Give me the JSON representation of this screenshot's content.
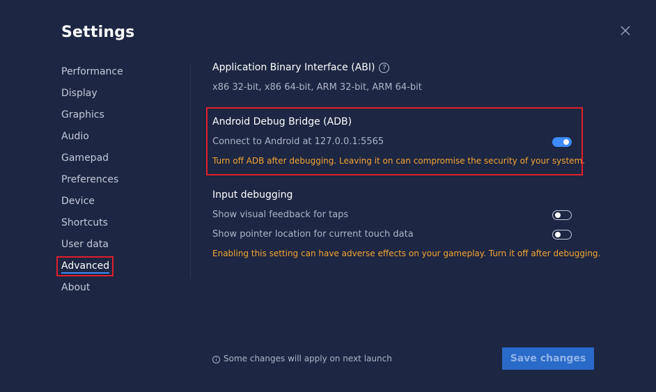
{
  "title": "Settings",
  "sidebar": {
    "items": [
      {
        "label": "Performance"
      },
      {
        "label": "Display"
      },
      {
        "label": "Graphics"
      },
      {
        "label": "Audio"
      },
      {
        "label": "Gamepad"
      },
      {
        "label": "Preferences"
      },
      {
        "label": "Device"
      },
      {
        "label": "Shortcuts"
      },
      {
        "label": "User data"
      },
      {
        "label": "Advanced"
      },
      {
        "label": "About"
      }
    ],
    "active": "Advanced"
  },
  "abi": {
    "title": "Application Binary Interface (ABI)",
    "help_icon": "?",
    "value": "x86 32-bit, x86 64-bit, ARM 32-bit, ARM 64-bit"
  },
  "adb": {
    "title": "Android Debug Bridge (ADB)",
    "connect_label": "Connect to Android at 127.0.0.1:5565",
    "enabled": true,
    "warning": "Turn off ADB after debugging. Leaving it on can compromise the security of your system."
  },
  "input_debugging": {
    "title": "Input debugging",
    "taps_label": "Show visual feedback for taps",
    "taps_enabled": false,
    "pointer_label": "Show pointer location for current touch data",
    "pointer_enabled": false,
    "warning": "Enabling this setting can have adverse effects on your gameplay. Turn it off after debugging."
  },
  "footer": {
    "info_icon": "i",
    "note": "Some changes will apply on next launch",
    "save_label": "Save changes"
  },
  "colors": {
    "background": "#1d2642",
    "accent": "#3d8bff",
    "warning": "#f5a532",
    "highlight": "#e0202a",
    "save_button": "#2a6ac9"
  }
}
